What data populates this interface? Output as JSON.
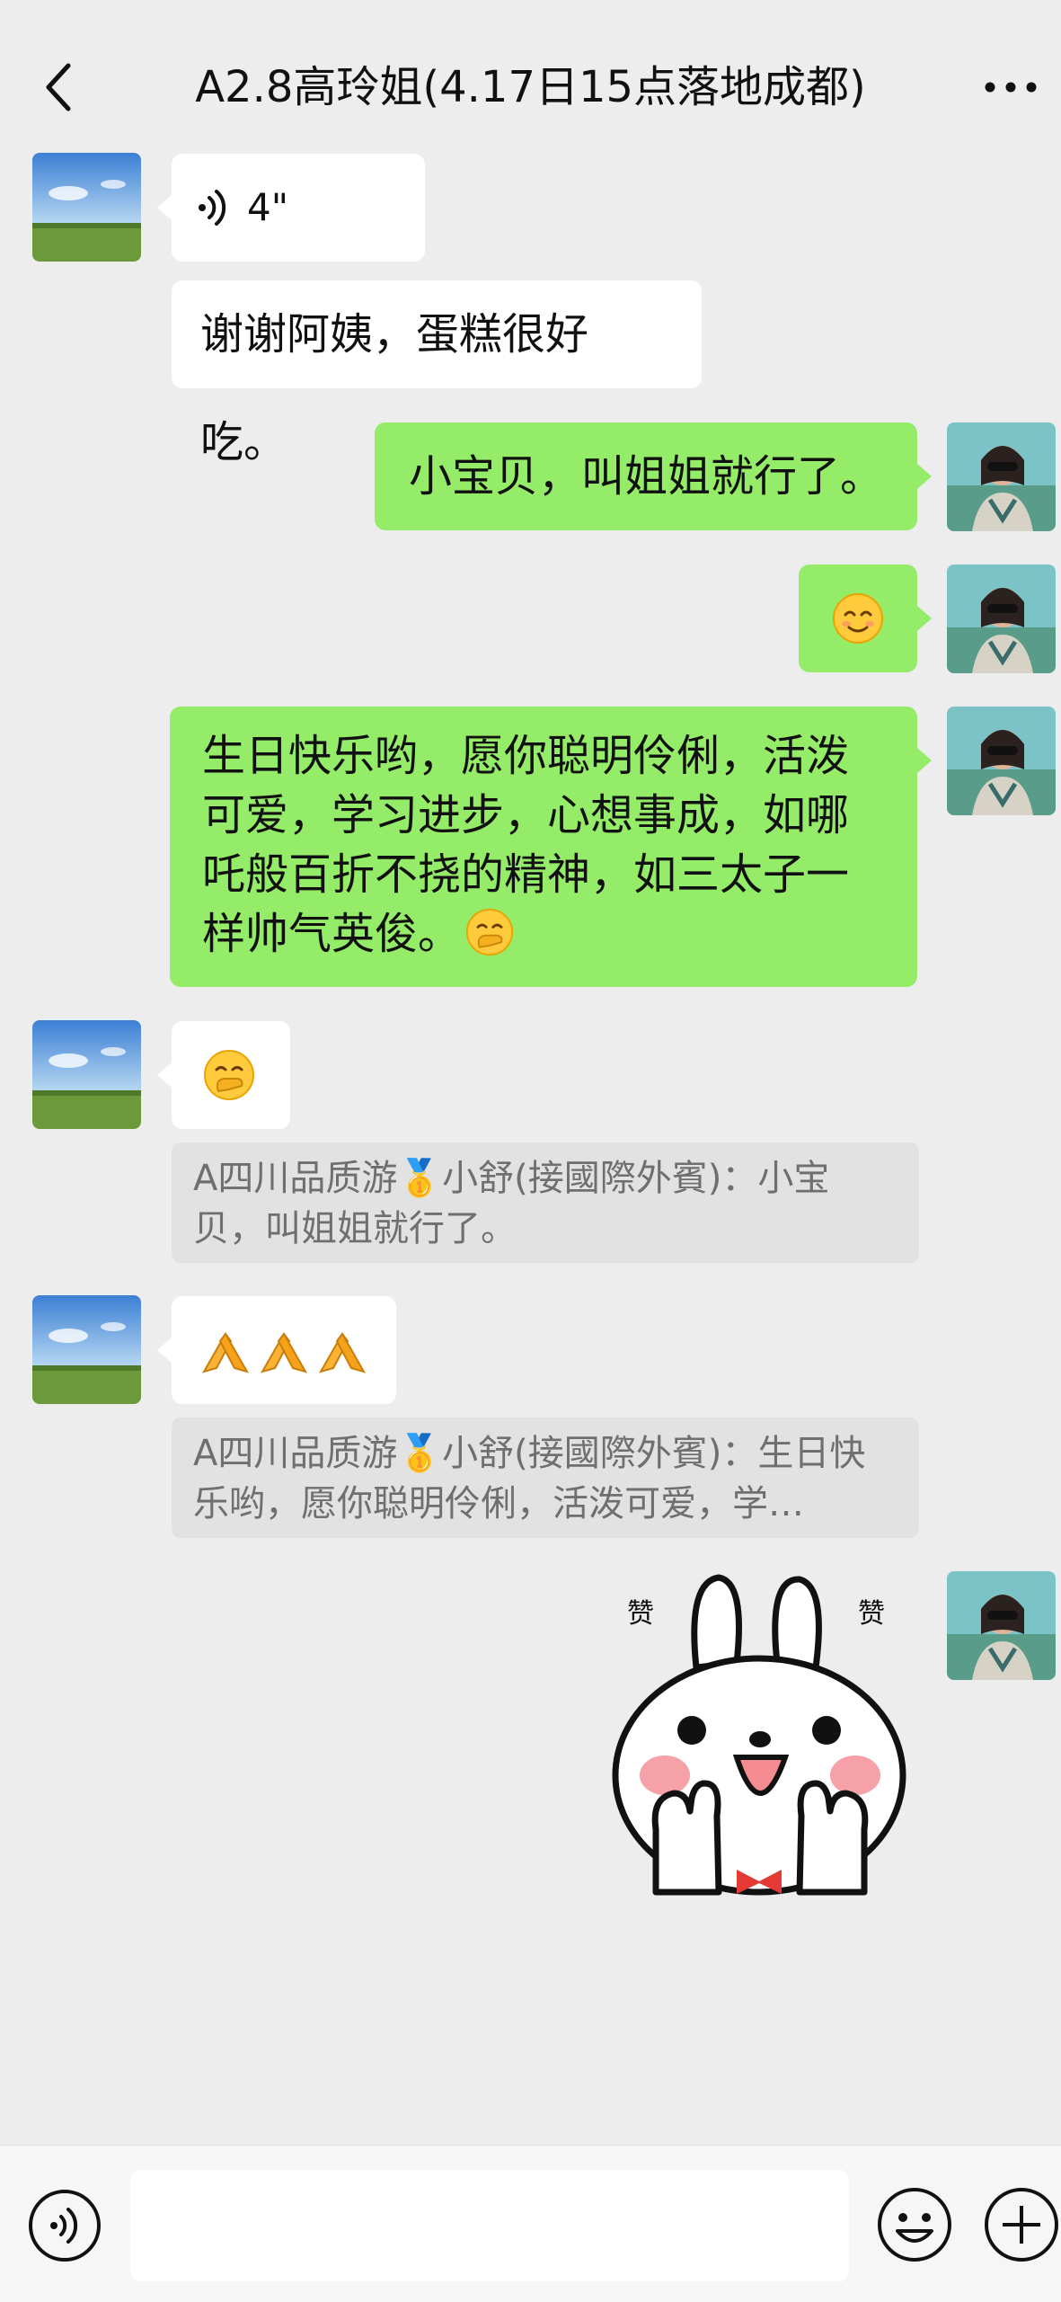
{
  "header": {
    "title": "A2.8高玲姐(4.17日15点落地成都)"
  },
  "messages": {
    "m1_voice_duration": "4\"",
    "m2_text": "谢谢阿姨，蛋糕很好吃。",
    "m3_text": "小宝贝，叫姐姐就行了。",
    "m5_text": "生日快乐哟，愿你聪明伶俐，活泼可爱，学习进步，心想事成，如哪吒般百折不挠的精神，如三太子一样帅气英俊。",
    "q1_text": "A四川品质游🥇小舒(接國際外賓)：小宝贝，叫姐姐就行了。",
    "q2_text": "A四川品质游🥇小舒(接國際外賓)：生日快乐哟，愿你聪明伶俐，活泼可爱，学…",
    "sticker_text": "赞"
  },
  "colors": {
    "background": "#ededed",
    "bubble_green": "#95ec69",
    "bubble_white": "#ffffff",
    "quote_bg": "#e2e2e2"
  },
  "icons": {
    "back": "chevron-left-icon",
    "more": "more-dots-icon",
    "voice": "voice-icon",
    "emoji": "emoji-icon",
    "plus": "plus-icon"
  }
}
